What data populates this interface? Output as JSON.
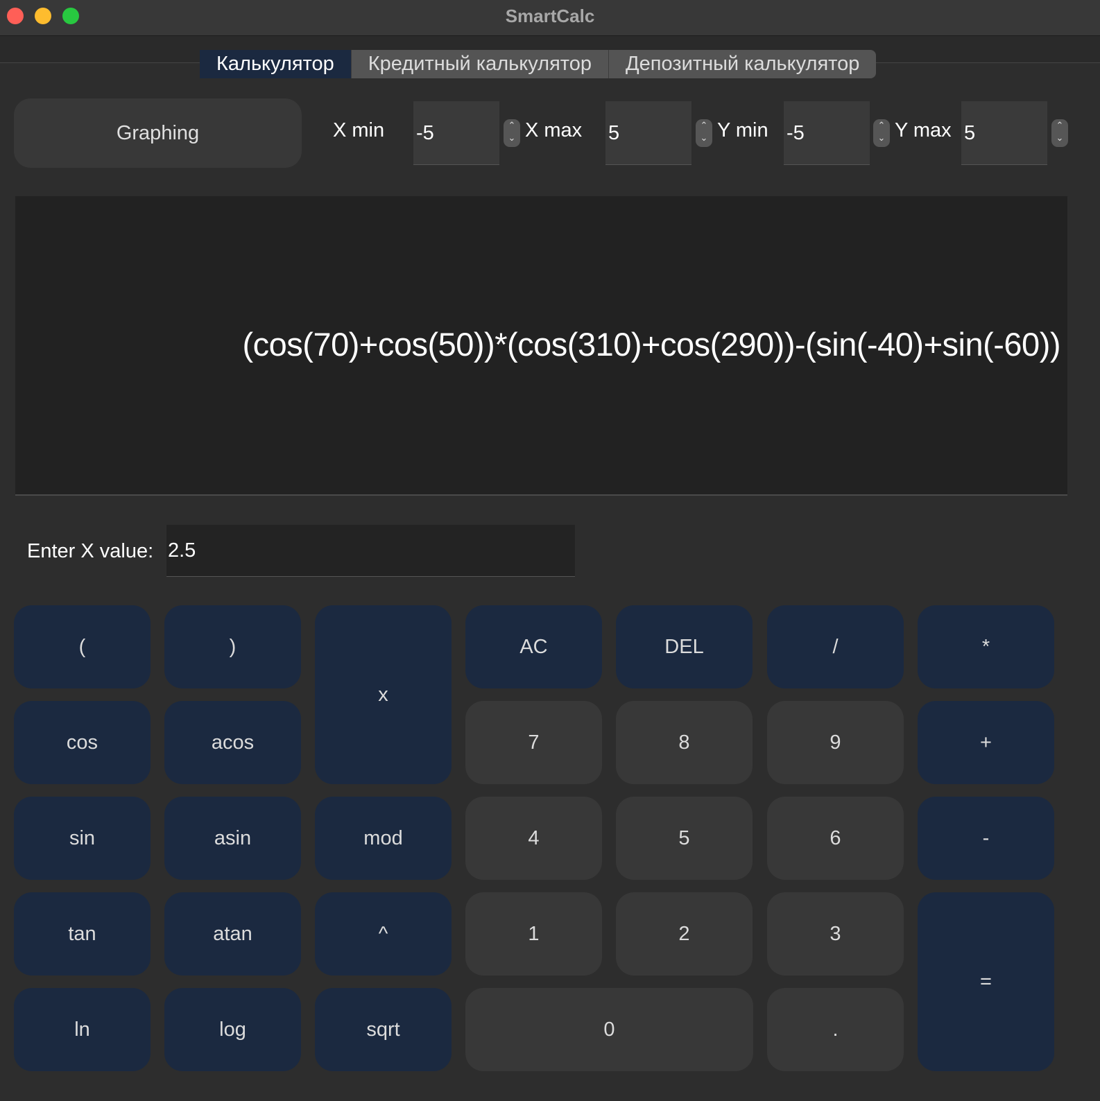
{
  "window": {
    "title": "SmartCalc"
  },
  "tabs": [
    {
      "label": "Калькулятор",
      "active": true
    },
    {
      "label": "Кредитный калькулятор",
      "active": false
    },
    {
      "label": "Депозитный калькулятор",
      "active": false
    }
  ],
  "graph": {
    "button_label": "Graphing",
    "x_min_label": "X min",
    "x_min_value": "-5",
    "x_max_label": "X max",
    "x_max_value": "5",
    "y_min_label": "Y min",
    "y_min_value": "-5",
    "y_max_label": "Y max",
    "y_max_value": "5"
  },
  "display": {
    "expression": "(cos(70)+cos(50))*(cos(310)+cos(290))-(sin(-40)+sin(-60))"
  },
  "x_input": {
    "label": "Enter X value:",
    "value": "2.5"
  },
  "keys": {
    "lparen": "(",
    "rparen": ")",
    "x": "x",
    "ac": "AC",
    "del": "DEL",
    "div": "/",
    "mul": "*",
    "cos": "cos",
    "acos": "acos",
    "seven": "7",
    "eight": "8",
    "nine": "9",
    "plus": "+",
    "sin": "sin",
    "asin": "asin",
    "mod": "mod",
    "four": "4",
    "five": "5",
    "six": "6",
    "minus": "-",
    "tan": "tan",
    "atan": "atan",
    "pow": "^",
    "one": "1",
    "two": "2",
    "three": "3",
    "equals": "=",
    "ln": "ln",
    "log": "log",
    "sqrt": "sqrt",
    "zero": "0",
    "dot": "."
  },
  "colors": {
    "accent": "#1b2940",
    "digit_key": "#383838",
    "background": "#2d2d2d"
  }
}
